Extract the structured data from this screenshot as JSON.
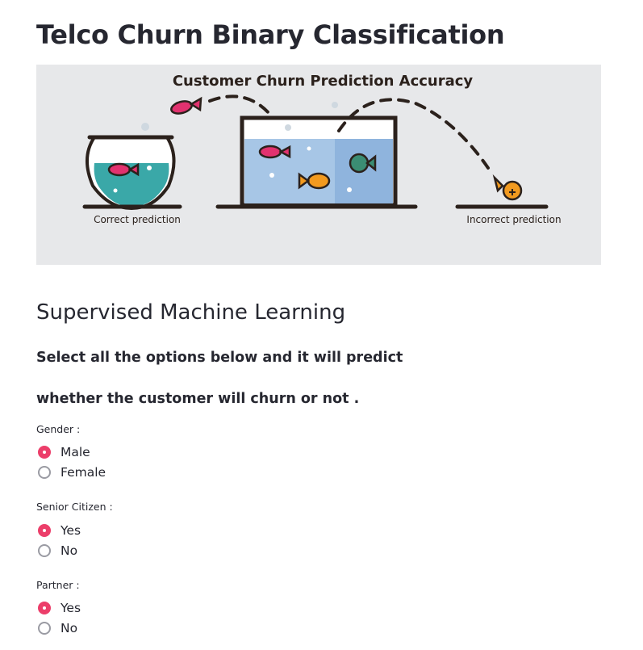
{
  "page": {
    "title": "Telco Churn Binary Classification",
    "subtitle": "Supervised Machine Learning",
    "instruction_line1": "Select all the options below and it will predict",
    "instruction_line2": "whether the customer will churn or not ."
  },
  "banner": {
    "title": "Customer Churn Prediction Accuracy",
    "left_caption": "Correct prediction",
    "right_caption": "Incorrect prediction"
  },
  "colors": {
    "accent": "#ec3e6a",
    "banner_bg": "#e7e8ea",
    "text": "#262730"
  },
  "form": {
    "gender": {
      "label": "Gender :",
      "options": [
        "Male",
        "Female"
      ],
      "selected": "Male"
    },
    "senior_citizen": {
      "label": "Senior Citizen :",
      "options": [
        "Yes",
        "No"
      ],
      "selected": "Yes"
    },
    "partner": {
      "label": "Partner :",
      "options": [
        "Yes",
        "No"
      ],
      "selected": "Yes"
    }
  }
}
